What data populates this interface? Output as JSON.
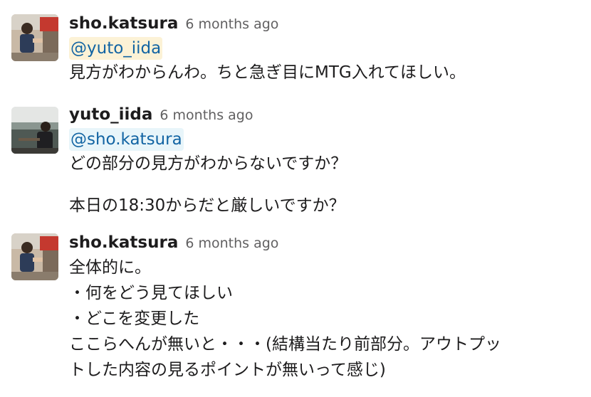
{
  "messages": [
    {
      "user": "sho.katsura",
      "time": "6 months ago",
      "mention": "@yuto_iida",
      "lines": [
        "見方がわからんわ。ちと急ぎ目にMTG入れてほしい。"
      ]
    },
    {
      "user": "yuto_iida",
      "time": "6 months ago",
      "mention": "@sho.katsura",
      "lines": [
        "どの部分の見方がわからないですか？",
        "本日の18:30からだと厳しいですか？"
      ]
    },
    {
      "user": "sho.katsura",
      "time": "6 months ago",
      "lines": [
        "全体的に。",
        "・何をどう見てほしい",
        "・どこを変更した",
        "ここらへんが無いと・・・(結構当たり前部分。アウトプッ",
        "トした内容の見るポイントが無いって感じ)"
      ]
    }
  ],
  "colors": {
    "link": "#1264a3",
    "mention_self_bg": "#fcf2d6",
    "mention_other_bg": "#e8f5fa",
    "timestamp": "#616061",
    "text": "#1d1c1d"
  }
}
